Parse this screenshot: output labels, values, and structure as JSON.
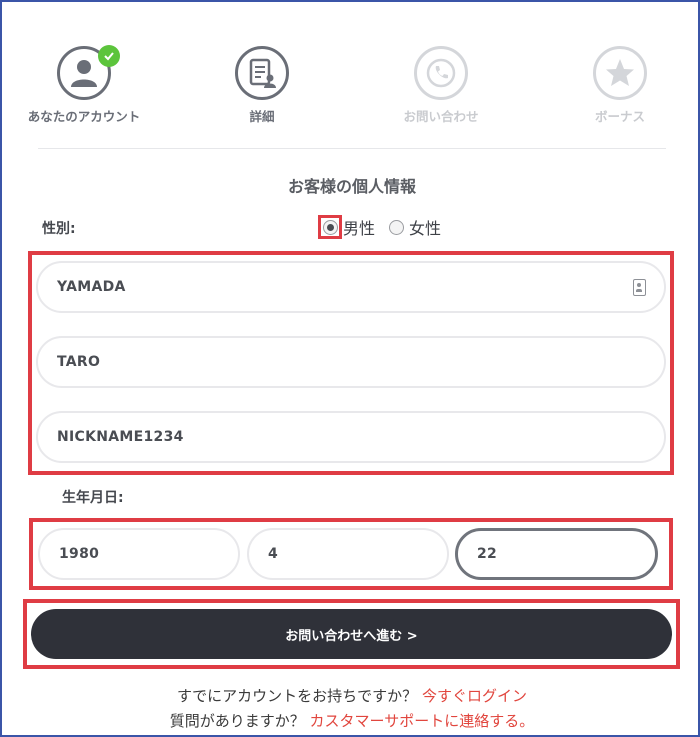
{
  "steps": [
    {
      "label": "あなたのアカウント",
      "icon": "user-icon",
      "status": "done"
    },
    {
      "label": "詳細",
      "icon": "document-user-icon",
      "status": "current"
    },
    {
      "label": "お問い合わせ",
      "icon": "phone-icon",
      "status": "todo"
    },
    {
      "label": "ボーナス",
      "icon": "star-icon",
      "status": "todo"
    }
  ],
  "form": {
    "section_title": "お客様の個人情報",
    "gender_label": "性別:",
    "gender_options": [
      "男性",
      "女性"
    ],
    "gender_selected": "男性",
    "last_name": "YAMADA",
    "first_name": "TARO",
    "nickname": "NICKNAME1234",
    "dob_label": "生年月日:",
    "dob_year": "1980",
    "dob_month": "4",
    "dob_day": "22",
    "submit_label": "お問い合わせへ進む >"
  },
  "footer": {
    "login_text": "すでにアカウントをお持ちですか？",
    "login_link": "今すぐログイン",
    "support_text": "質問がありますか？",
    "support_link": "カスタマーサポートに連絡する。"
  },
  "colors": {
    "highlight": "#df3c44",
    "check": "#5cc43c",
    "button": "#2f3139",
    "link": "#e1463e",
    "frame": "#3b55a8"
  }
}
